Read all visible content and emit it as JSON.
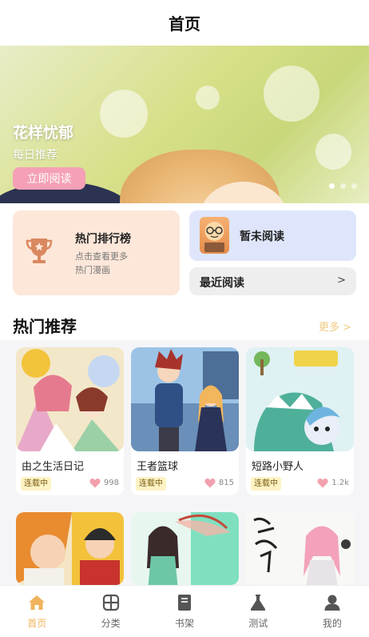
{
  "header": {
    "title": "首页"
  },
  "banner": {
    "title": "花样忧郁",
    "subtitle": "每日推荐",
    "button_label": "立即阅读",
    "dots_count": 3,
    "active_dot": 0
  },
  "quick": {
    "rank": {
      "title": "热门排行榜",
      "line1": "点击查看更多",
      "line2": "热门漫画"
    },
    "no_read": {
      "title": "暂未阅读"
    },
    "recent": {
      "title": "最近阅读",
      "arrow": ">"
    }
  },
  "hot": {
    "title": "热门推荐",
    "more": "更多 >",
    "items": [
      {
        "title": "由之生活日记",
        "status": "连载中",
        "likes": "998"
      },
      {
        "title": "王者篮球",
        "status": "连载中",
        "likes": "815"
      },
      {
        "title": "短路小野人",
        "status": "连载中",
        "likes": "1.2k"
      }
    ]
  },
  "tabs": [
    {
      "label": "首页",
      "icon": "home-icon",
      "active": true
    },
    {
      "label": "分类",
      "icon": "grid-icon",
      "active": false
    },
    {
      "label": "书架",
      "icon": "book-icon",
      "active": false
    },
    {
      "label": "测试",
      "icon": "flask-icon",
      "active": false
    },
    {
      "label": "我的",
      "icon": "user-icon",
      "active": false
    }
  ],
  "colors": {
    "accent": "#f0b35c",
    "banner_button": "#f5a0b6",
    "rank_card": "#fde7d9",
    "noread_card": "#dfe6fb",
    "more_link": "#f0cb84",
    "heart": "#f2a0ae"
  }
}
